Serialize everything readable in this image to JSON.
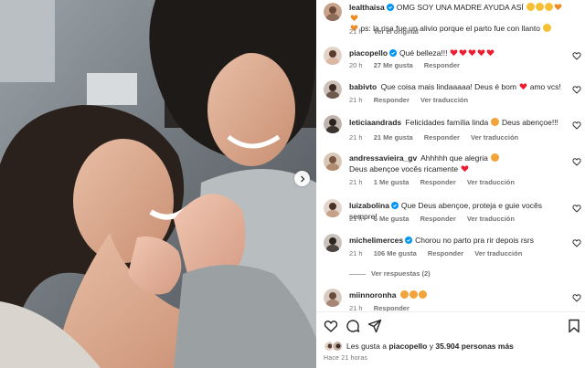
{
  "post": {
    "author": "lealthaisa",
    "caption_line1": "OMG SOY UNA MADRE AYUDA ASÍ",
    "caption_line2": "ps: la risa fue un alivio porque el parto fue con llanto",
    "time": "21 h",
    "see_original": "Ver el original"
  },
  "comments": [
    {
      "user": "piacopello",
      "verified": true,
      "text": "Qué belleza!!!",
      "time": "20 h",
      "likes": "27 Me gusta",
      "reply": "Responder",
      "translate": ""
    },
    {
      "user": "babivto",
      "verified": false,
      "text": "Que coisa mais lindaaaaa! Deus é bom",
      "text2": "amo vcs!",
      "time": "21 h",
      "likes": "",
      "reply": "Responder",
      "translate": "Ver traducción"
    },
    {
      "user": "leticiaandrads",
      "verified": false,
      "text": "Felicidades família linda",
      "text2": "Deus abençoe!!!",
      "time": "21 h",
      "likes": "21 Me gusta",
      "reply": "Responder",
      "translate": "Ver traducción"
    },
    {
      "user": "andressavieira_gv",
      "verified": false,
      "text": "Ahhhhh que alegria",
      "text2": "Deus abençoe vocês ricamente",
      "time": "21 h",
      "likes": "1 Me gusta",
      "reply": "Responder",
      "translate": "Ver traducción"
    },
    {
      "user": "luizabolina",
      "verified": true,
      "text": "Que Deus abençoe, proteja e guie vocês sempre!",
      "time": "21 h",
      "likes": "6 Me gusta",
      "reply": "Responder",
      "translate": "Ver traducción"
    },
    {
      "user": "michelimerces",
      "verified": true,
      "text": "Chorou no parto pra rir depois rsrs",
      "time": "21 h",
      "likes": "106 Me gusta",
      "reply": "Responder",
      "translate": "Ver traducción"
    },
    {
      "user": "miinnoronha",
      "verified": false,
      "text": "",
      "time": "21 h",
      "likes": "",
      "reply": "Responder",
      "translate": ""
    }
  ],
  "view_replies": "Ver respuestas (2)",
  "likes_summary": {
    "prefix": "Les gusta a",
    "user": "piacopello",
    "middle": "y",
    "count": "35.904 personas más"
  },
  "posted_ago": "Hace 21 horas",
  "colors": {
    "heart_red": "#ed1c2e",
    "muted": "#737373",
    "verified_blue": "#0095f6"
  },
  "icons": [
    "like-icon",
    "comment-icon",
    "share-icon",
    "save-icon",
    "next-arrow-icon"
  ]
}
